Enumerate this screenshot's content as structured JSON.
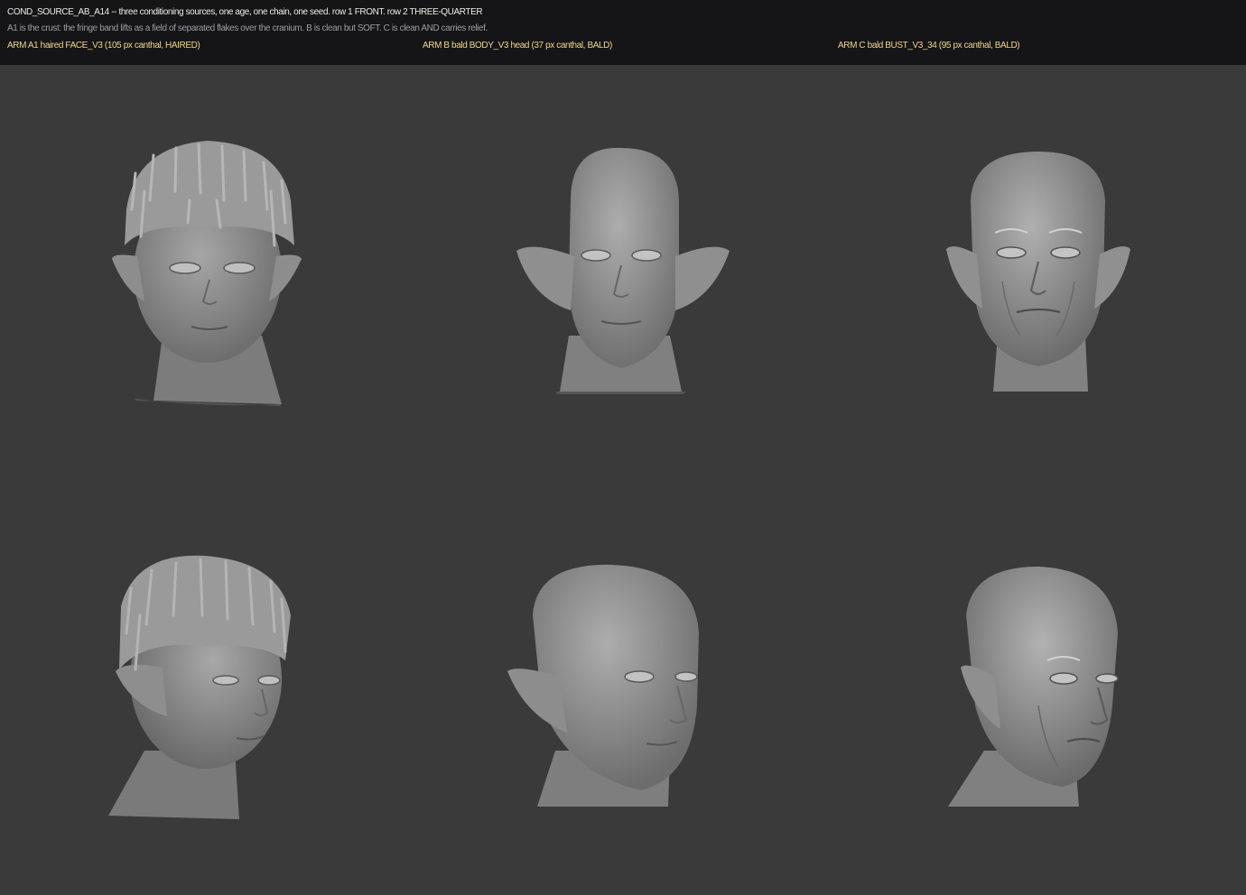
{
  "header": {
    "title": "COND_SOURCE_AB_A14 -- three conditioning sources, one age, one chain, one seed.  row 1 FRONT.  row 2 THREE-QUARTER",
    "note": "A1 is the crust: the fringe band lifts as a field of separated flakes over the cranium.  B is clean but SOFT.  C is clean AND carries relief.",
    "arms": [
      {
        "label": "ARM A1  haired FACE_V3  (105 px canthal, HAIRED)"
      },
      {
        "label": "ARM B  bald BODY_V3 head (37 px canthal, BALD)"
      },
      {
        "label": "ARM C  bald BUST_V3_34 (95 px canthal, BALD)"
      }
    ]
  },
  "colors": {
    "header_bg": "#151517",
    "viewport_bg": "#3a3a3a",
    "title_text": "#ecebe6",
    "note_text": "#9d9d9d",
    "arm_label_text": "#f0d487",
    "mesh_gray": "#8f8f8f"
  },
  "renders": [
    {
      "row": "front",
      "arm": "A1",
      "icon": "haired-head-front-render"
    },
    {
      "row": "front",
      "arm": "B",
      "icon": "bald-soft-head-front-render"
    },
    {
      "row": "front",
      "arm": "C",
      "icon": "bald-relief-head-front-render"
    },
    {
      "row": "three-quarter",
      "arm": "A1",
      "icon": "haired-head-threequarter-render"
    },
    {
      "row": "three-quarter",
      "arm": "B",
      "icon": "bald-soft-head-threequarter-render"
    },
    {
      "row": "three-quarter",
      "arm": "C",
      "icon": "bald-relief-head-threequarter-render"
    }
  ]
}
